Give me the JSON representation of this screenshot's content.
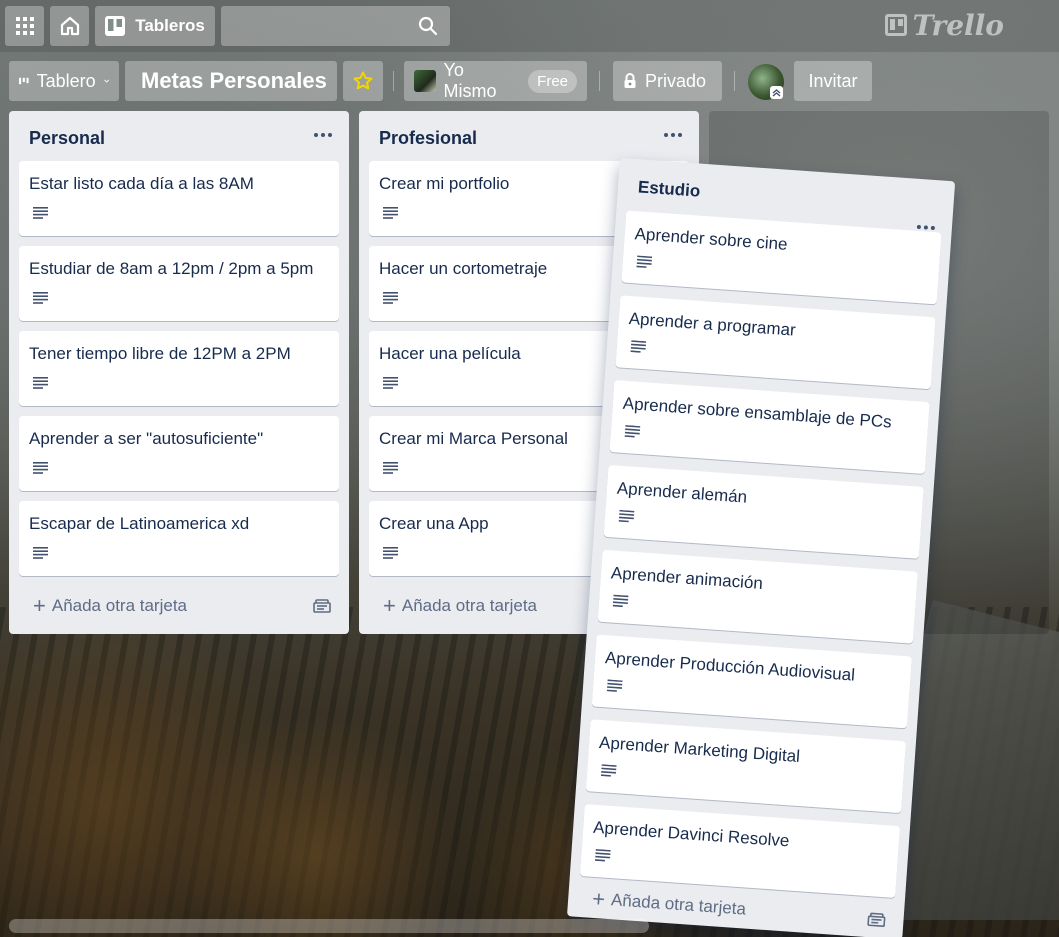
{
  "header": {
    "boards_label": "Tableros",
    "search_placeholder": "",
    "logo_text": "Trello"
  },
  "board": {
    "view_label": "Tablero",
    "title": "Metas Personales",
    "team_name": "Yo Mismo",
    "plan_badge": "Free",
    "privacy_label": "Privado",
    "invite_label": "Invitar"
  },
  "lists": [
    {
      "name": "Personal",
      "cards": [
        "Estar listo cada día a las 8AM",
        "Estudiar de 8am a 12pm / 2pm a 5pm",
        "Tener tiempo libre de 12PM a 2PM",
        "Aprender a ser \"autosuficiente\"",
        "Escapar de Latinoamerica xd"
      ],
      "add_label": "Añada otra tarjeta"
    },
    {
      "name": "Profesional",
      "cards": [
        "Crear mi portfolio",
        "Hacer un cortometraje",
        "Hacer una película",
        "Crear mi Marca Personal",
        "Crear una App"
      ],
      "add_label": "Añada otra tarjeta"
    },
    {
      "name": "Estudio",
      "cards": [
        "Aprender sobre cine",
        "Aprender a programar",
        "Aprender sobre ensamblaje de PCs",
        "Aprender alemán",
        "Aprender animación",
        "Aprender Producción Audiovisual",
        "Aprender Marketing Digital",
        "Aprender Davinci Resolve"
      ],
      "add_label": "Añada otra tarjeta"
    }
  ],
  "colors": {
    "list_bg": "#ebecf0",
    "card_text": "#172b4d",
    "muted_text": "#5e6c84",
    "star": "#f2d600"
  },
  "icons": {
    "apps": "grid-icon",
    "home": "home-icon",
    "boards": "board-icon",
    "search": "search-icon",
    "star": "star-icon",
    "lock": "lock-icon",
    "description": "description-icon",
    "template": "card-template-icon"
  }
}
